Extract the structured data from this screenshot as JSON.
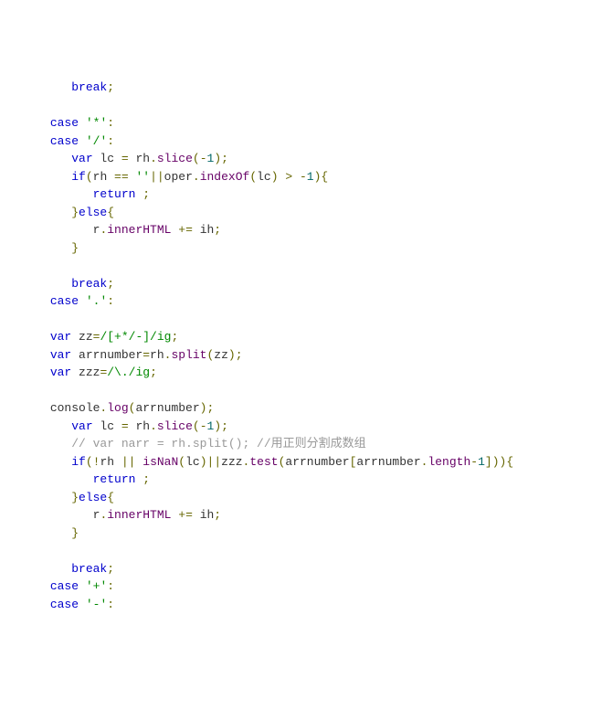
{
  "code": {
    "l01_indent": "         ",
    "l01_break": "break",
    "l01_semi": ";",
    "l02_blank": "",
    "l03_indent": "      ",
    "l03_case": "case",
    "l03_space": " ",
    "l03_lit": "'*'",
    "l03_colon": ":",
    "l04_indent": "      ",
    "l04_case": "case",
    "l04_lit": "'/'",
    "l04_colon": ":",
    "l05_indent": "         ",
    "l05_var": "var",
    "l05_lc": " lc ",
    "l05_eq": "=",
    "l05_rh": " rh",
    "l05_dot": ".",
    "l05_slice": "slice",
    "l05_paren_open": "(",
    "l05_neg1": "-1",
    "l05_paren_close": ")",
    "l05_semi": ";",
    "l06_indent": "         ",
    "l06_if": "if",
    "l06_open": "(",
    "l06_rh": "rh ",
    "l06_eqeq": "==",
    "l06_empty": " ''",
    "l06_oror": "||",
    "l06_oper": "oper",
    "l06_dot": ".",
    "l06_indexOf": "indexOf",
    "l06_open2": "(",
    "l06_lc": "lc",
    "l06_close2": ")",
    "l06_gt": " > ",
    "l06_neg1": "-1",
    "l06_close": ")",
    "l06_brace": "{",
    "l07_indent": "            ",
    "l07_return": "return",
    "l07_tail": " ;",
    "l08_indent": "         ",
    "l08_brace": "}",
    "l08_else": "else",
    "l08_brace2": "{",
    "l09_indent": "            ",
    "l09_r": "r",
    "l09_dot": ".",
    "l09_innerHTML": "innerHTML",
    "l09_pluseq": " += ",
    "l09_ih": "ih",
    "l09_semi": ";",
    "l10_indent": "         ",
    "l10_brace": "}",
    "l11_blank": "",
    "l12_indent": "         ",
    "l12_break": "break",
    "l12_semi": ";",
    "l13_indent": "      ",
    "l13_case": "case",
    "l13_lit": "'.'",
    "l13_colon": ":",
    "l14_blank": "",
    "l15_indent": "      ",
    "l15_var": "var",
    "l15_zz": " zz",
    "l15_eq": "=",
    "l15_regex": "/[+*/-]/ig",
    "l15_semi": ";",
    "l16_indent": "      ",
    "l16_var": "var",
    "l16_arr": " arrnumber",
    "l16_eq": "=",
    "l16_rh": "rh",
    "l16_dot": ".",
    "l16_split": "split",
    "l16_open": "(",
    "l16_zz": "zz",
    "l16_close": ")",
    "l16_semi": ";",
    "l17_indent": "      ",
    "l17_var": "var",
    "l17_zzz": " zzz",
    "l17_eq": "=",
    "l17_regex": "/\\./ig",
    "l17_semi": ";",
    "l18_blank": "",
    "l19_indent": "      ",
    "l19_console": "console",
    "l19_dot": ".",
    "l19_log": "log",
    "l19_open": "(",
    "l19_arr": "arrnumber",
    "l19_close": ")",
    "l19_semi": ";",
    "l20_indent": "         ",
    "l20_var": "var",
    "l20_lc": " lc ",
    "l20_eq": "=",
    "l20_rh": " rh",
    "l20_dot": ".",
    "l20_slice": "slice",
    "l20_open": "(",
    "l20_neg1": "-1",
    "l20_close": ")",
    "l20_semi": ";",
    "l21_indent": "         ",
    "l21_comment": "// var narr = rh.split(); //用正则分割成数组",
    "l22_indent": "         ",
    "l22_if": "if",
    "l22_open": "(",
    "l22_bang": "!",
    "l22_rh": "rh ",
    "l22_oror": "||",
    "l22_space": " ",
    "l22_isNaN": "isNaN",
    "l22_open2": "(",
    "l22_lc": "lc",
    "l22_close2": ")",
    "l22_oror2": "||",
    "l22_zzz": "zzz",
    "l22_dot": ".",
    "l22_test": "test",
    "l22_open3": "(",
    "l22_arr": "arrnumber",
    "l22_br_open": "[",
    "l22_arr2": "arrnumber",
    "l22_dot2": ".",
    "l22_length": "length",
    "l22_minus": "-",
    "l22_one": "1",
    "l22_br_close": "]",
    "l22_close3": ")",
    "l22_close": ")",
    "l22_brace": "{",
    "l23_indent": "            ",
    "l23_return": "return",
    "l23_tail": " ;",
    "l24_indent": "         ",
    "l24_brace": "}",
    "l24_else": "else",
    "l24_brace2": "{",
    "l25_indent": "            ",
    "l25_r": "r",
    "l25_dot": ".",
    "l25_innerHTML": "innerHTML",
    "l25_pluseq": " += ",
    "l25_ih": "ih",
    "l25_semi": ";",
    "l26_indent": "         ",
    "l26_brace": "}",
    "l27_blank": "",
    "l28_indent": "         ",
    "l28_break": "break",
    "l28_semi": ";",
    "l29_indent": "      ",
    "l29_case": "case",
    "l29_lit": "'+'",
    "l29_colon": ":",
    "l30_indent": "      ",
    "l30_case": "case",
    "l30_lit": "'-'",
    "l30_colon": ":"
  }
}
